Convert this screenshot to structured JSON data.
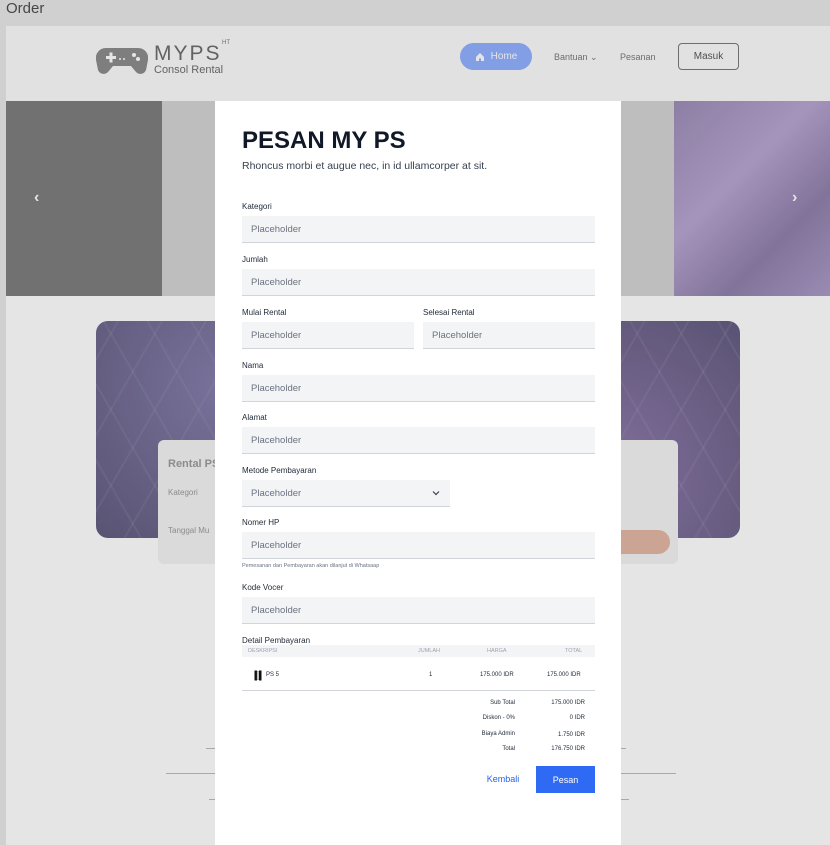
{
  "frame": {
    "label": "Order"
  },
  "navbar": {
    "brand": "MYPS",
    "brand_sup": "HT",
    "brand_sub": "Consol Rental",
    "home": "Home",
    "bantuan": "Bantuan",
    "pesanan": "Pesanan",
    "masuk": "Masuk"
  },
  "background": {
    "rental_title": "Rental PS",
    "kategori": "Kategori",
    "tanggal": "Tanggal Mu"
  },
  "modal": {
    "title": "PESAN MY PS",
    "subtitle": "Rhoncus morbi et augue nec, in id ullamcorper at sit.",
    "fields": {
      "kategori": {
        "label": "Kategori",
        "placeholder": "Placeholder"
      },
      "jumlah": {
        "label": "Jumlah",
        "placeholder": "Placeholder"
      },
      "mulai": {
        "label": "Mulai Rental",
        "placeholder": "Placeholder"
      },
      "selesai": {
        "label": "Selesai Rental",
        "placeholder": "Placeholder"
      },
      "nama": {
        "label": "Nama",
        "placeholder": "Placeholder"
      },
      "alamat": {
        "label": "Alamat",
        "placeholder": "Placeholder"
      },
      "metode": {
        "label": "Metode Pembayaran",
        "value": "Placeholder"
      },
      "nomor": {
        "label": "Nomer HP",
        "placeholder": "Placeholder",
        "hint": "Pemesanan dan Pembayaran akan dilanjut di Whatsaap"
      },
      "voucher": {
        "label": "Kode Vocer",
        "placeholder": "Placeholder"
      }
    },
    "detail": {
      "title": "Detail Pembayaran",
      "headers": {
        "deskripsi": "DESKRIPSI",
        "jumlah": "JUMLAH",
        "harga": "HARGA",
        "total": "TOTAL"
      },
      "row": {
        "deskripsi": "PS 5",
        "jumlah": "1",
        "harga": "175.000 IDR",
        "total": "175.000 IDR"
      },
      "summary": {
        "subtotal_label": "Sub Total",
        "subtotal": "175.000 IDR",
        "diskon_label": "Diskon - 0%",
        "diskon": "0 IDR",
        "admin_label": "Biaya Admin",
        "admin": "1.750 IDR",
        "total_label": "Total",
        "total": "176.750 IDR"
      }
    },
    "buttons": {
      "back": "Kembali",
      "submit": "Pesan"
    }
  },
  "colors": {
    "primary": "#2f6af5",
    "link": "#2563eb",
    "input_bg": "#f3f4f6"
  }
}
